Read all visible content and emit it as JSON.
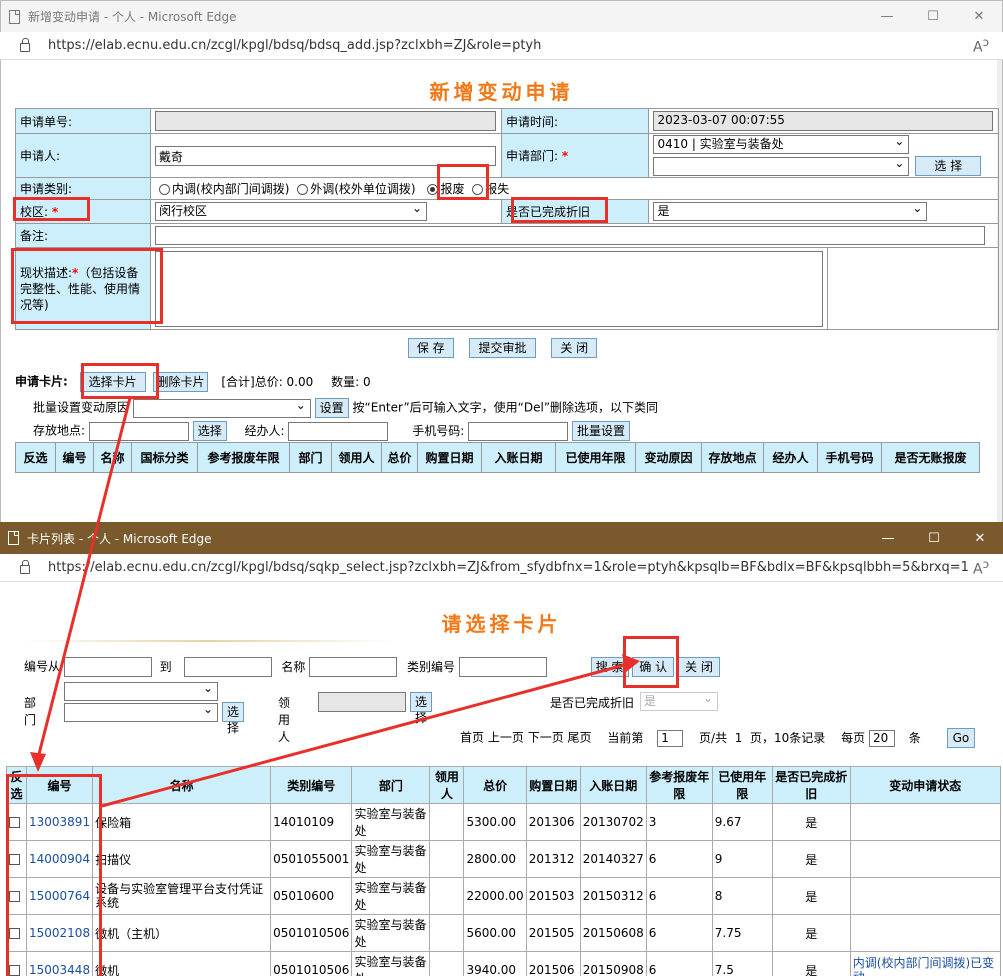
{
  "top_window": {
    "title": "新增变动申请 - 个人 - Microsoft Edge",
    "url": "https://elab.ecnu.edu.cn/zcgl/kpgl/bdsq/bdsq_add.jsp?zclxbh=ZJ&role=ptyh",
    "heading": "新增变动申请",
    "labels": {
      "apply_no": "申请单号:",
      "apply_time": "申请时间:",
      "applicant": "申请人:",
      "apply_dept": "申请部门:",
      "apply_type": "申请类别:",
      "campus": "校区:",
      "depreciation": "是否已完成折旧",
      "remarks": "备注:",
      "status_desc": "现状描述:",
      "status_desc_hint": "（包括设备完整性、性能、使用情况等)"
    },
    "values": {
      "apply_no": "",
      "apply_time": "2023-03-07 00:07:55",
      "applicant": "戴奇",
      "dept_selected": "0410 | 实验室与装备处",
      "dept_second": "",
      "campus_selected": "闵行校区",
      "depreciation_selected": "是",
      "remarks": ""
    },
    "dept_select_button": "选 择",
    "radio_options": [
      "内调(校内部门间调拨)",
      "外调(校外单位调拨)",
      "报废",
      "报失"
    ],
    "radio_selected_index": 2,
    "actions": {
      "save": "保 存",
      "submit": "提交审批",
      "close": "关 闭"
    },
    "card_section": {
      "label": "申请卡片:",
      "select_card": "选择卡片",
      "delete_card": "删除卡片",
      "total_label": "[合计]总价: 0.00",
      "count_label": "数量: 0"
    },
    "batch": {
      "reason_label": "批量设置变动原因",
      "reason_value": "",
      "set_button": "设置",
      "hint": "按“Enter”后可输入文字，使用“Del”删除选项，以下类同",
      "location_label": "存放地点:",
      "location_button": "选择",
      "handler_label": "经办人:",
      "phone_label": "手机号码:",
      "batch_set_button": "批量设置"
    },
    "card_columns": [
      "反选",
      "编号",
      "名称",
      "国标分类",
      "参考报废年限",
      "部门",
      "领用人",
      "总价",
      "购置日期",
      "入账日期",
      "已使用年限",
      "变动原因",
      "存放地点",
      "经办人",
      "手机号码",
      "是否无账报废"
    ]
  },
  "bottom_window": {
    "title": "卡片列表 - 个人 - Microsoft Edge",
    "url": "https://elab.ecnu.edu.cn/zcgl/kpgl/bdsq/sqkp_select.jsp?zclxbh=ZJ&from_sfydbfnx=1&role=ptyh&kpsqlb=BF&bdlx=BF&kpsqlbbh=5&brxq=1",
    "heading": "请选择卡片",
    "search": {
      "no_from": "编号从",
      "to": "到",
      "name": "名称",
      "category_no": "类别编号",
      "search_btn": "搜 索",
      "confirm_btn": "确 认",
      "close_btn": "关 闭",
      "dept": "部门",
      "dept_select_btn": "选 择",
      "receiver": "领用人",
      "receiver_select_btn": "选 择",
      "depreciation": "是否已完成折旧",
      "depreciation_value": "是"
    },
    "pager": {
      "first": "首页",
      "prev": "上一页",
      "next": "下一页",
      "last": "尾页",
      "current_label": "当前第",
      "current": "1",
      "total_label": "页/共  1  页，10条记录",
      "per_page_label": "每页",
      "per_page": "20",
      "unit": "条",
      "go": "Go"
    },
    "columns": [
      "反选",
      "编号",
      "名称",
      "类别编号",
      "部门",
      "领用人",
      "总价",
      "购置日期",
      "入账日期",
      "参考报废年限",
      "已使用年限",
      "是否已完成折旧",
      "变动申请状态"
    ],
    "rows": [
      {
        "no": "13003891",
        "name": "保险箱",
        "cat": "14010109",
        "dept": "实验室与装备处",
        "receiver": "",
        "price": "5300.00",
        "buy": "201306",
        "book": "20130702",
        "life": "3",
        "used": "9.67",
        "dep": "是",
        "status": ""
      },
      {
        "no": "14000904",
        "name": "扫描仪",
        "cat": "0501055001",
        "dept": "实验室与装备处",
        "receiver": "",
        "price": "2800.00",
        "buy": "201312",
        "book": "20140327",
        "life": "6",
        "used": "9",
        "dep": "是",
        "status": ""
      },
      {
        "no": "15000764",
        "name": "设备与实验室管理平台支付凭证系统",
        "cat": "05010600",
        "dept": "实验室与装备处",
        "receiver": "",
        "price": "22000.00",
        "buy": "201503",
        "book": "20150312",
        "life": "6",
        "used": "8",
        "dep": "是",
        "status": ""
      },
      {
        "no": "15002108",
        "name": "微机（主机）",
        "cat": "0501010506",
        "dept": "实验室与装备处",
        "receiver": "",
        "price": "5600.00",
        "buy": "201505",
        "book": "20150608",
        "life": "6",
        "used": "7.75",
        "dep": "是",
        "status": ""
      },
      {
        "no": "15003448",
        "name": "微机",
        "cat": "0501010506",
        "dept": "实验室与装备处",
        "receiver": "",
        "price": "3940.00",
        "buy": "201506",
        "book": "20150908",
        "life": "6",
        "used": "7.5",
        "dep": "是",
        "status": "内调(校内部门间调拨)已变动"
      }
    ]
  },
  "colors": {
    "accent_orange": "#f07a1a",
    "label_bg": "#cdeffb",
    "annotation_red": "#e8302b",
    "titlebar_brown": "#7a5a2d"
  }
}
